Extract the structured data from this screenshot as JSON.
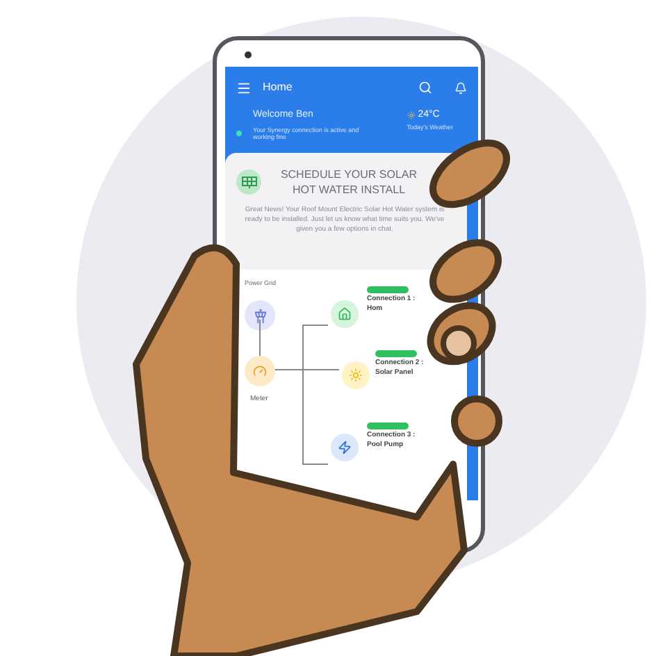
{
  "header": {
    "title": "Home"
  },
  "welcome": {
    "title": "Welcome Ben",
    "text": "Your Synergy connection is active and working fine",
    "temperature": "24°C",
    "weather_label": "Today's Weather"
  },
  "card": {
    "title": "SCHEDULE YOUR SOLAR HOT WATER INSTALL",
    "body": "Great News! Your Roof Mount Electric Solar Hot Water system is ready to be installed. Just let us know what time suits you. We've given you a few options in chat."
  },
  "diagram": {
    "source_label": "Power Grid",
    "meter_label": "Meter",
    "connections": [
      {
        "name": "Connection 1 : Hom",
        "kind": "home"
      },
      {
        "name": "Connection 2 : Solar Panel",
        "kind": "solar"
      },
      {
        "name": "Connection 3 : Pool Pump",
        "kind": "pump"
      }
    ]
  }
}
